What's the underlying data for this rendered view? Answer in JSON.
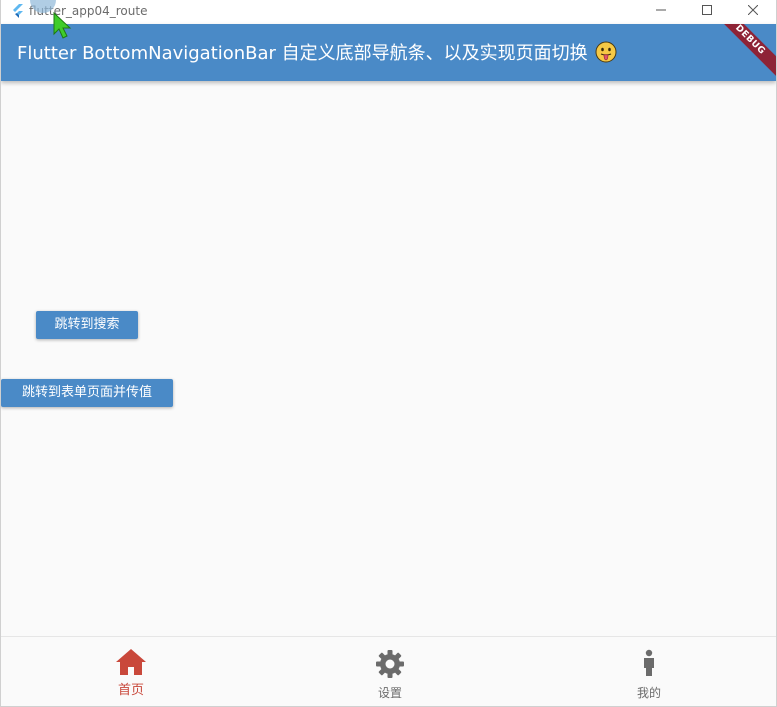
{
  "window": {
    "title": "flutter_app04_route"
  },
  "appbar": {
    "title": "Flutter BottomNavigationBar 自定义底部导航条、以及实现页面切换",
    "debug_banner": "DEBUG",
    "background": "#4a8ac7"
  },
  "body": {
    "buttons": [
      {
        "label": "跳转到搜索"
      },
      {
        "label": "跳转到表单页面并传值"
      }
    ]
  },
  "bottom_nav": {
    "items": [
      {
        "label": "首页",
        "icon": "home-icon",
        "active": true
      },
      {
        "label": "设置",
        "icon": "settings-gear-icon",
        "active": false
      },
      {
        "label": "我的",
        "icon": "person-icon",
        "active": false
      }
    ],
    "active_color": "#c9483b",
    "inactive_color": "#6b6b6b"
  }
}
